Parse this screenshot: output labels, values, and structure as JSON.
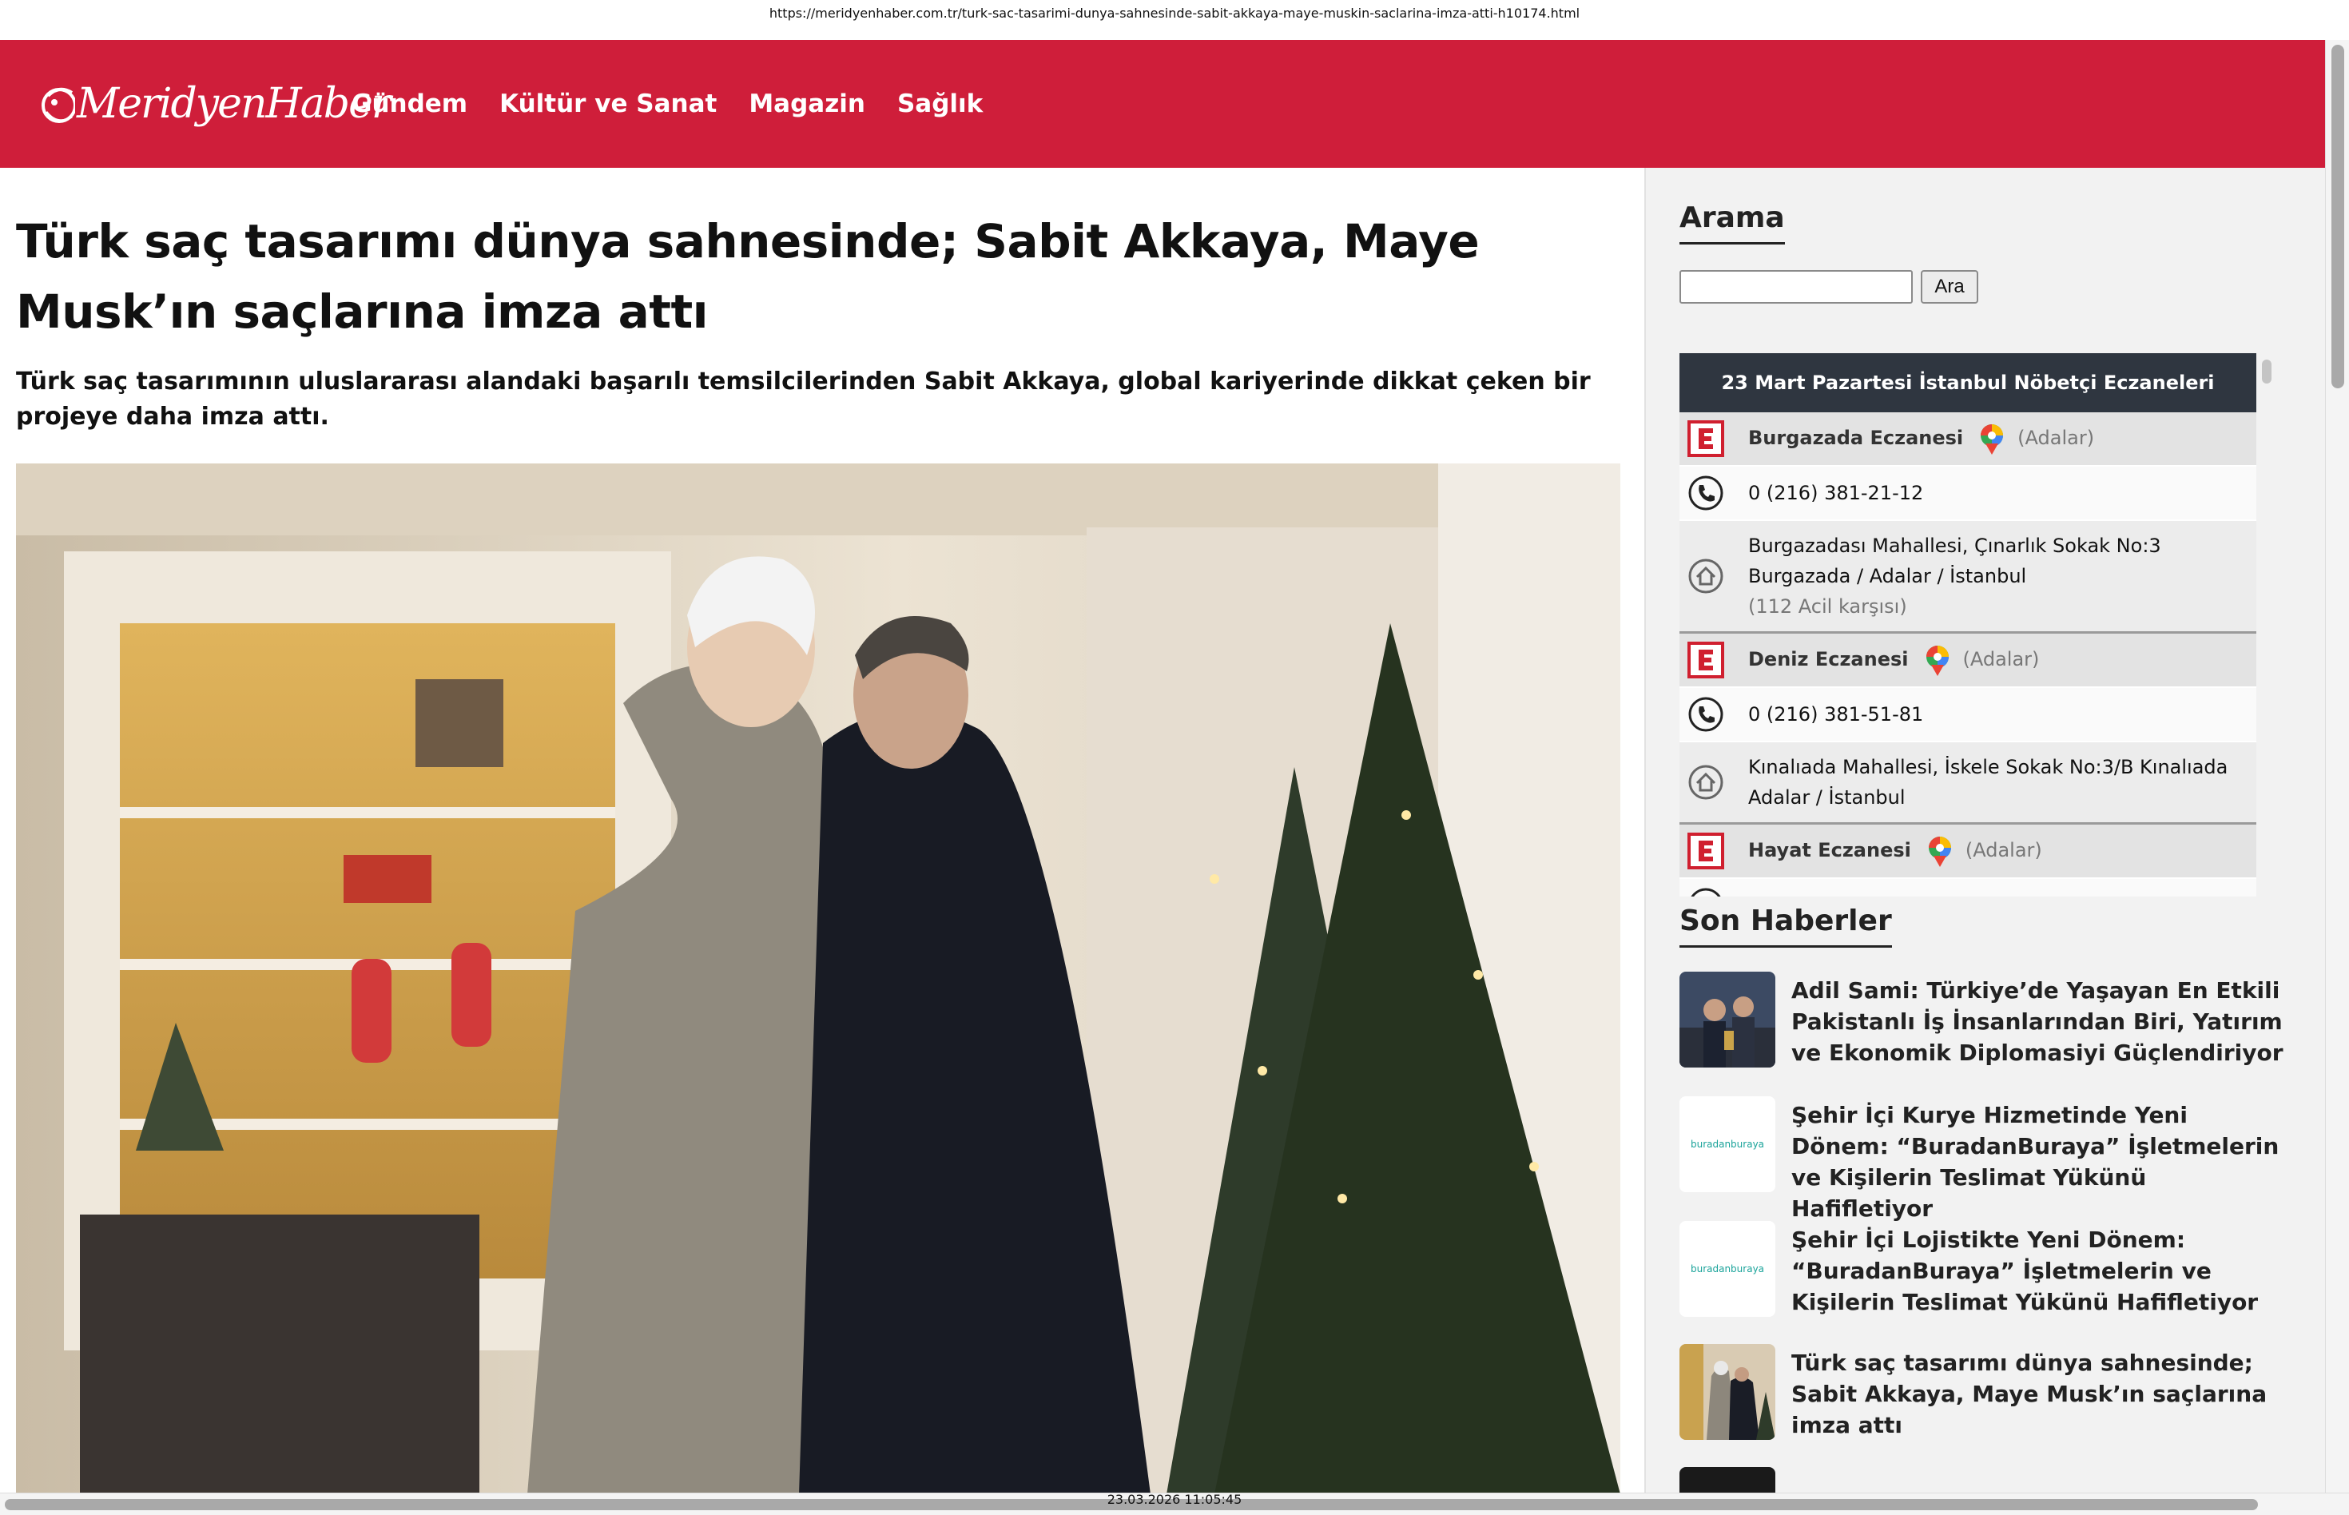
{
  "url": "https://meridyenhaber.com.tr/turk-sac-tasarimi-dunya-sahnesinde-sabit-akkaya-maye-muskin-saclarina-imza-atti-h10174.html",
  "site": {
    "logo_text": "MeridyenHaber",
    "brand_color": "#cf1e3a"
  },
  "nav": [
    "Gündem",
    "Kültür ve Sanat",
    "Magazin",
    "Sağlık"
  ],
  "article": {
    "title": "Türk saç tasarımı dünya sahnesinde; Sabit Akkaya, Maye Musk’ın saçlarına imza attı",
    "spot": "Türk saç tasarımının uluslararası alandaki başarılı temsilcilerinden Sabit Akkaya, global kariyerinde dikkat çeken bir projeye daha imza attı."
  },
  "search": {
    "heading": "Arama",
    "button": "Ara",
    "value": ""
  },
  "pharmacy": {
    "header": "23 Mart Pazartesi İstanbul Nöbetçi Eczaneleri",
    "items": [
      {
        "name": "Burgazada Eczanesi",
        "district": "(Adalar)",
        "phone": "0 (216) 381-21-12",
        "address": "Burgazadası Mahallesi, Çınarlık Sokak No:3 Burgazada / Adalar / İstanbul",
        "note": "(112 Acil karşısı)"
      },
      {
        "name": "Deniz Eczanesi",
        "district": "(Adalar)",
        "phone": "0 (216) 381-51-81",
        "address": "Kınalıada Mahallesi, İskele Sokak No:3/B Kınalıada Adalar / İstanbul",
        "note": ""
      },
      {
        "name": "Hayat Eczanesi",
        "district": "(Adalar)"
      }
    ]
  },
  "latest": {
    "heading": "Son Haberler",
    "items": [
      {
        "title": "Adil Sami: Türkiye’de Yaşayan En Etkili Pakistanlı İş İnsanlarından Biri, Yatırım ve Ekonomik Diplomasiyi Güçlendiriyor"
      },
      {
        "title": "Şehir İçi Kurye Hizmetinde Yeni Dönem: “BuradanBuraya” İşletmelerin ve Kişilerin Teslimat Yükünü Hafifletiyor",
        "thumb_label": "buradanburaya"
      },
      {
        "title": "Şehir İçi Lojistikte Yeni Dönem: “BuradanBuraya” İşletmelerin ve Kişilerin Teslimat Yükünü Hafifletiyor",
        "thumb_label": "buradanburaya"
      },
      {
        "title": "Türk saç tasarımı dünya sahnesinde; Sabit Akkaya, Maye Musk’ın saçlarına imza attı"
      }
    ]
  },
  "timestamp": "23.03.2026 11:05:45"
}
